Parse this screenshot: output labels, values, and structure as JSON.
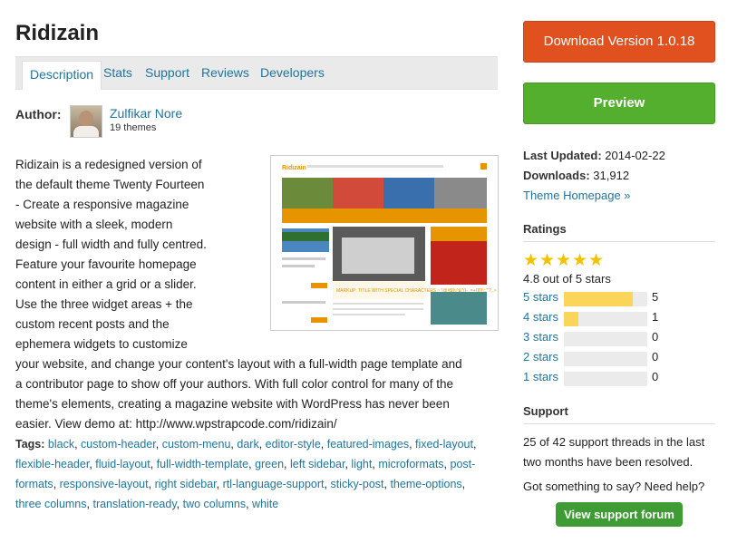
{
  "theme": {
    "title": "Ridizain"
  },
  "tabs": [
    {
      "label": "Description"
    },
    {
      "label": "Stats"
    },
    {
      "label": "Support"
    },
    {
      "label": "Reviews"
    },
    {
      "label": "Developers"
    }
  ],
  "author": {
    "label": "Author:",
    "name": "Zulfikar Nore",
    "themes": "19 themes"
  },
  "screenshot": {
    "brand": "Ridizain",
    "headline": "MARKUP: TITLE WITH SPECIAL CHARACTERS ~`!@#$%^&*()-_=+{}[]/\\;:'\"?,.>"
  },
  "description": "Ridizain is a redesigned version of the default theme Twenty Fourteen - Create a responsive magazine website with a sleek, modern design - full width and fully centred. Feature your favourite homepage content in either a grid or a slider. Use the three widget areas + the custom recent posts and the ephemera widgets to customize your website, and change your content's layout with a full-width page template and a contributor page to show off your authors. With full color control for many of the theme's elements, creating a magazine website with WordPress has never been easier. View demo at: http://www.wpstrapcode.com/ridizain/",
  "tags_label": "Tags:",
  "tags": [
    "black",
    "custom-header",
    "custom-menu",
    "dark",
    "editor-style",
    "featured-images",
    "fixed-layout",
    "flexible-header",
    "fluid-layout",
    "full-width-template",
    "green",
    "left sidebar",
    "light",
    "microformats",
    "post-formats",
    "responsive-layout",
    "right sidebar",
    "rtl-language-support",
    "sticky-post",
    "theme-options",
    "three columns",
    "translation-ready",
    "two columns",
    "white"
  ],
  "sidebar": {
    "download_label": "Download Version 1.0.18",
    "preview_label": "Preview",
    "last_updated_label": "Last Updated:",
    "last_updated": "2014-02-22",
    "downloads_label": "Downloads:",
    "downloads": "31,912",
    "homepage_link": "Theme Homepage »",
    "ratings_heading": "Ratings",
    "rating_summary": "4.8 out of 5 stars",
    "rating_value": 4.8,
    "ratings": [
      {
        "label": "5 stars",
        "count": "5",
        "fraction": 0.83
      },
      {
        "label": "4 stars",
        "count": "1",
        "fraction": 0.17
      },
      {
        "label": "3 stars",
        "count": "0",
        "fraction": 0
      },
      {
        "label": "2 stars",
        "count": "0",
        "fraction": 0
      },
      {
        "label": "1 stars",
        "count": "0",
        "fraction": 0
      }
    ],
    "support_heading": "Support",
    "support_text": "25 of 42 support threads in the last two months have been resolved.",
    "support_question": "Got something to say? Need help?",
    "support_button": "View support forum"
  },
  "colors": {
    "accent": "#21759b",
    "download": "#e0511f",
    "preview": "#55af2f",
    "support": "#3f9c35",
    "star": "#f2c200",
    "bar": "#fbd55a"
  }
}
